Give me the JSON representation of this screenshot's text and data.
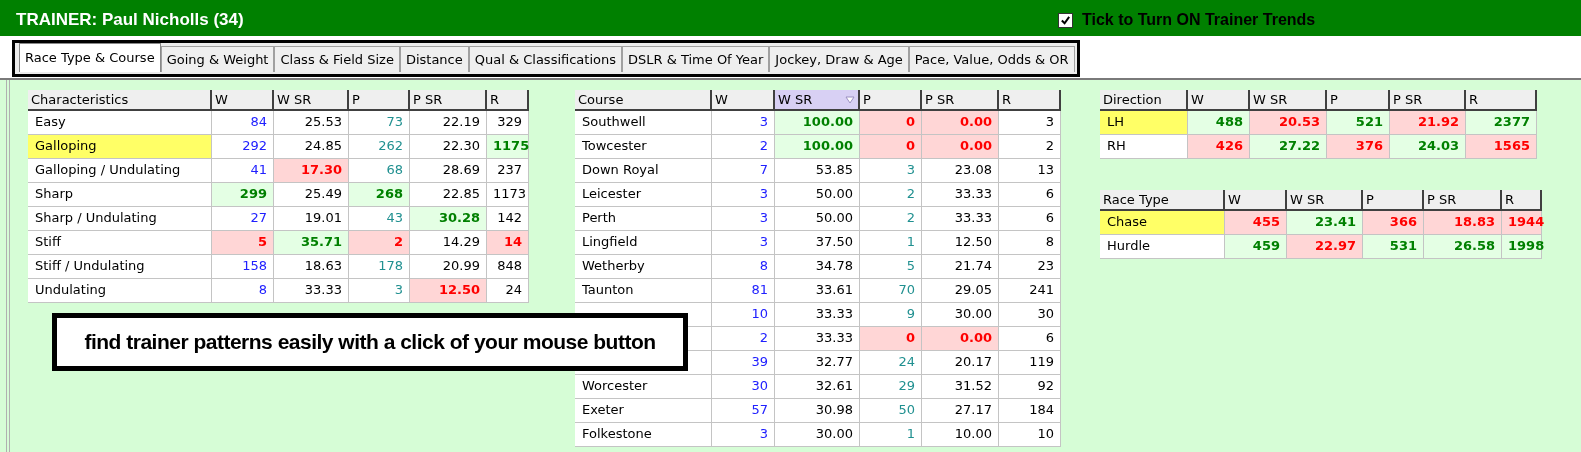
{
  "title": "TRAINER: Paul Nicholls (34)",
  "trends_toggle": {
    "label": "Tick to Turn ON Trainer Trends",
    "checked": true
  },
  "tabs": [
    {
      "label": "Race Type & Course",
      "selected": true
    },
    {
      "label": "Going & Weight",
      "selected": false
    },
    {
      "label": "Class & Field Size",
      "selected": false
    },
    {
      "label": "Distance",
      "selected": false
    },
    {
      "label": "Qual & Classifications",
      "selected": false
    },
    {
      "label": "DSLR & Time Of Year",
      "selected": false
    },
    {
      "label": "Jockey, Draw & Age",
      "selected": false
    },
    {
      "label": "Pace, Value, Odds & OR",
      "selected": false
    }
  ],
  "tables": [
    {
      "columns": [
        {
          "label": "Characteristics",
          "sorted": false
        },
        {
          "label": "W",
          "sorted": false
        },
        {
          "label": "W SR",
          "sorted": false
        },
        {
          "label": "P",
          "sorted": false
        },
        {
          "label": "P SR",
          "sorted": false
        },
        {
          "label": "R",
          "sorted": false
        }
      ],
      "rows": [
        {
          "name": "Easy",
          "highlighted": false,
          "cells": [
            {
              "text": "84",
              "color": "#2020ff"
            },
            {
              "text": "25.53",
              "color": "#000000"
            },
            {
              "text": "73",
              "color": "#209090"
            },
            {
              "text": "22.19",
              "color": "#000000"
            },
            {
              "text": "329",
              "color": "#000000"
            }
          ]
        },
        {
          "name": "Galloping",
          "highlighted": true,
          "cells": [
            {
              "text": "292",
              "color": "#2020ff"
            },
            {
              "text": "24.85",
              "color": "#000000"
            },
            {
              "text": "262",
              "color": "#209090"
            },
            {
              "text": "22.30",
              "color": "#000000"
            },
            {
              "text": "1175",
              "color": "#008000"
            }
          ]
        },
        {
          "name": "Galloping / Undulating",
          "highlighted": false,
          "cells": [
            {
              "text": "41",
              "color": "#2020ff"
            },
            {
              "text": "17.30",
              "color": "#ff0000"
            },
            {
              "text": "68",
              "color": "#209090"
            },
            {
              "text": "28.69",
              "color": "#000000"
            },
            {
              "text": "237",
              "color": "#000000"
            }
          ]
        },
        {
          "name": "Sharp",
          "highlighted": false,
          "cells": [
            {
              "text": "299",
              "color": "#008000"
            },
            {
              "text": "25.49",
              "color": "#000000"
            },
            {
              "text": "268",
              "color": "#008000"
            },
            {
              "text": "22.85",
              "color": "#000000"
            },
            {
              "text": "1173",
              "color": "#000000"
            }
          ]
        },
        {
          "name": "Sharp / Undulating",
          "highlighted": false,
          "cells": [
            {
              "text": "27",
              "color": "#2020ff"
            },
            {
              "text": "19.01",
              "color": "#000000"
            },
            {
              "text": "43",
              "color": "#209090"
            },
            {
              "text": "30.28",
              "color": "#008000"
            },
            {
              "text": "142",
              "color": "#000000"
            }
          ]
        },
        {
          "name": "Stiff",
          "highlighted": false,
          "cells": [
            {
              "text": "5",
              "color": "#ff0000"
            },
            {
              "text": "35.71",
              "color": "#008000"
            },
            {
              "text": "2",
              "color": "#ff0000"
            },
            {
              "text": "14.29",
              "color": "#000000"
            },
            {
              "text": "14",
              "color": "#ff0000"
            }
          ]
        },
        {
          "name": "Stiff / Undulating",
          "highlighted": false,
          "cells": [
            {
              "text": "158",
              "color": "#2020ff"
            },
            {
              "text": "18.63",
              "color": "#000000"
            },
            {
              "text": "178",
              "color": "#209090"
            },
            {
              "text": "20.99",
              "color": "#000000"
            },
            {
              "text": "848",
              "color": "#000000"
            }
          ]
        },
        {
          "name": "Undulating",
          "highlighted": false,
          "cells": [
            {
              "text": "8",
              "color": "#2020ff"
            },
            {
              "text": "33.33",
              "color": "#000000"
            },
            {
              "text": "3",
              "color": "#209090"
            },
            {
              "text": "12.50",
              "color": "#ff0000"
            },
            {
              "text": "24",
              "color": "#000000"
            }
          ]
        }
      ]
    },
    {
      "columns": [
        {
          "label": "Course",
          "sorted": false
        },
        {
          "label": "W",
          "sorted": false
        },
        {
          "label": "W SR",
          "sorted": true
        },
        {
          "label": "P",
          "sorted": false
        },
        {
          "label": "P SR",
          "sorted": false
        },
        {
          "label": "R",
          "sorted": false
        }
      ],
      "rows": [
        {
          "name": "Southwell",
          "highlighted": false,
          "cells": [
            {
              "text": "3",
              "color": "#2020ff"
            },
            {
              "text": "100.00",
              "color": "#008000"
            },
            {
              "text": "0",
              "color": "#ff0000"
            },
            {
              "text": "0.00",
              "color": "#ff0000"
            },
            {
              "text": "3",
              "color": "#000000"
            }
          ]
        },
        {
          "name": "Towcester",
          "highlighted": false,
          "cells": [
            {
              "text": "2",
              "color": "#2020ff"
            },
            {
              "text": "100.00",
              "color": "#008000"
            },
            {
              "text": "0",
              "color": "#ff0000"
            },
            {
              "text": "0.00",
              "color": "#ff0000"
            },
            {
              "text": "2",
              "color": "#000000"
            }
          ]
        },
        {
          "name": "Down Royal",
          "highlighted": false,
          "cells": [
            {
              "text": "7",
              "color": "#2020ff"
            },
            {
              "text": "53.85",
              "color": "#000000"
            },
            {
              "text": "3",
              "color": "#209090"
            },
            {
              "text": "23.08",
              "color": "#000000"
            },
            {
              "text": "13",
              "color": "#000000"
            }
          ]
        },
        {
          "name": "Leicester",
          "highlighted": false,
          "cells": [
            {
              "text": "3",
              "color": "#2020ff"
            },
            {
              "text": "50.00",
              "color": "#000000"
            },
            {
              "text": "2",
              "color": "#209090"
            },
            {
              "text": "33.33",
              "color": "#000000"
            },
            {
              "text": "6",
              "color": "#000000"
            }
          ]
        },
        {
          "name": "Perth",
          "highlighted": false,
          "cells": [
            {
              "text": "3",
              "color": "#2020ff"
            },
            {
              "text": "50.00",
              "color": "#000000"
            },
            {
              "text": "2",
              "color": "#209090"
            },
            {
              "text": "33.33",
              "color": "#000000"
            },
            {
              "text": "6",
              "color": "#000000"
            }
          ]
        },
        {
          "name": "Lingfield",
          "highlighted": false,
          "cells": [
            {
              "text": "3",
              "color": "#2020ff"
            },
            {
              "text": "37.50",
              "color": "#000000"
            },
            {
              "text": "1",
              "color": "#209090"
            },
            {
              "text": "12.50",
              "color": "#000000"
            },
            {
              "text": "8",
              "color": "#000000"
            }
          ]
        },
        {
          "name": "Wetherby",
          "highlighted": false,
          "cells": [
            {
              "text": "8",
              "color": "#2020ff"
            },
            {
              "text": "34.78",
              "color": "#000000"
            },
            {
              "text": "5",
              "color": "#209090"
            },
            {
              "text": "21.74",
              "color": "#000000"
            },
            {
              "text": "23",
              "color": "#000000"
            }
          ]
        },
        {
          "name": "Taunton",
          "highlighted": false,
          "cells": [
            {
              "text": "81",
              "color": "#2020ff"
            },
            {
              "text": "33.61",
              "color": "#000000"
            },
            {
              "text": "70",
              "color": "#209090"
            },
            {
              "text": "29.05",
              "color": "#000000"
            },
            {
              "text": "241",
              "color": "#000000"
            }
          ]
        },
        {
          "highlighted": false,
          "cells": [
            {
              "text": "10",
              "color": "#2020ff"
            },
            {
              "text": "33.33",
              "color": "#000000"
            },
            {
              "text": "9",
              "color": "#209090"
            },
            {
              "text": "30.00",
              "color": "#000000"
            },
            {
              "text": "30",
              "color": "#000000"
            }
          ]
        },
        {
          "highlighted": false,
          "cells": [
            {
              "text": "2",
              "color": "#2020ff"
            },
            {
              "text": "33.33",
              "color": "#000000"
            },
            {
              "text": "0",
              "color": "#ff0000"
            },
            {
              "text": "0.00",
              "color": "#ff0000"
            },
            {
              "text": "6",
              "color": "#000000"
            }
          ]
        },
        {
          "highlighted": false,
          "cells": [
            {
              "text": "39",
              "color": "#2020ff"
            },
            {
              "text": "32.77",
              "color": "#000000"
            },
            {
              "text": "24",
              "color": "#209090"
            },
            {
              "text": "20.17",
              "color": "#000000"
            },
            {
              "text": "119",
              "color": "#000000"
            }
          ]
        },
        {
          "name": "Worcester",
          "highlighted": false,
          "cells": [
            {
              "text": "30",
              "color": "#2020ff"
            },
            {
              "text": "32.61",
              "color": "#000000"
            },
            {
              "text": "29",
              "color": "#209090"
            },
            {
              "text": "31.52",
              "color": "#000000"
            },
            {
              "text": "92",
              "color": "#000000"
            }
          ]
        },
        {
          "name": "Exeter",
          "highlighted": false,
          "cells": [
            {
              "text": "57",
              "color": "#2020ff"
            },
            {
              "text": "30.98",
              "color": "#000000"
            },
            {
              "text": "50",
              "color": "#209090"
            },
            {
              "text": "27.17",
              "color": "#000000"
            },
            {
              "text": "184",
              "color": "#000000"
            }
          ]
        },
        {
          "name": "Folkestone",
          "highlighted": false,
          "cells": [
            {
              "text": "3",
              "color": "#2020ff"
            },
            {
              "text": "30.00",
              "color": "#000000"
            },
            {
              "text": "1",
              "color": "#209090"
            },
            {
              "text": "10.00",
              "color": "#000000"
            },
            {
              "text": "10",
              "color": "#000000"
            }
          ]
        }
      ]
    },
    {
      "columns": [
        {
          "label": "Direction",
          "sorted": false
        },
        {
          "label": "W",
          "sorted": false
        },
        {
          "label": "W SR",
          "sorted": false
        },
        {
          "label": "P",
          "sorted": false
        },
        {
          "label": "P SR",
          "sorted": false
        },
        {
          "label": "R",
          "sorted": false
        }
      ],
      "rows": [
        {
          "name": "LH",
          "highlighted": true,
          "cells": [
            {
              "text": "488",
              "color": "#008000"
            },
            {
              "text": "20.53",
              "color": "#ff0000"
            },
            {
              "text": "521",
              "color": "#008000"
            },
            {
              "text": "21.92",
              "color": "#ff0000"
            },
            {
              "text": "2377",
              "color": "#008000"
            }
          ]
        },
        {
          "name": "RH",
          "highlighted": false,
          "cells": [
            {
              "text": "426",
              "color": "#ff0000"
            },
            {
              "text": "27.22",
              "color": "#008000"
            },
            {
              "text": "376",
              "color": "#ff0000"
            },
            {
              "text": "24.03",
              "color": "#008000"
            },
            {
              "text": "1565",
              "color": "#ff0000"
            }
          ]
        }
      ]
    },
    {
      "columns": [
        {
          "label": "Race Type",
          "sorted": false
        },
        {
          "label": "W",
          "sorted": false
        },
        {
          "label": "W SR",
          "sorted": false
        },
        {
          "label": "P",
          "sorted": false
        },
        {
          "label": "P SR",
          "sorted": false
        },
        {
          "label": "R",
          "sorted": false
        }
      ],
      "rows": [
        {
          "name": "Chase",
          "highlighted": true,
          "cells": [
            {
              "text": "455",
              "color": "#ff0000"
            },
            {
              "text": "23.41",
              "color": "#008000"
            },
            {
              "text": "366",
              "color": "#ff0000"
            },
            {
              "text": "18.83",
              "color": "#ff0000"
            },
            {
              "text": "1944",
              "color": "#ff0000"
            }
          ]
        },
        {
          "name": "Hurdle",
          "highlighted": false,
          "cells": [
            {
              "text": "459",
              "color": "#008000"
            },
            {
              "text": "22.97",
              "color": "#ff0000"
            },
            {
              "text": "531",
              "color": "#008000"
            },
            {
              "text": "26.58",
              "color": "#008000"
            },
            {
              "text": "1998",
              "color": "#008000"
            }
          ]
        }
      ]
    }
  ],
  "callout": "find trainer patterns easily with a click of your mouse button"
}
